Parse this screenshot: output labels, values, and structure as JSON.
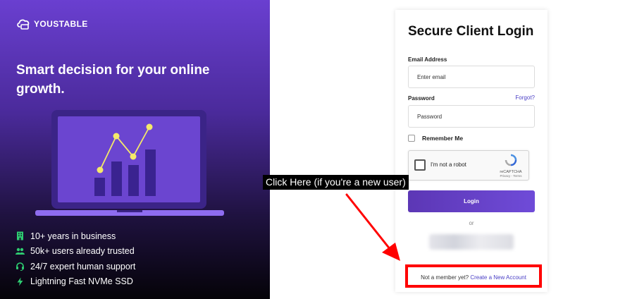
{
  "brand": {
    "name": "YOUSTABLE"
  },
  "promo": {
    "headline": "Smart decision for your online growth.",
    "features": [
      {
        "icon": "building-icon",
        "text": "10+ years in business"
      },
      {
        "icon": "users-icon",
        "text": "50k+ users already trusted"
      },
      {
        "icon": "headset-icon",
        "text": "24/7 expert human support"
      },
      {
        "icon": "lightning-icon",
        "text": "Lightning Fast NVMe SSD"
      }
    ]
  },
  "login": {
    "title": "Secure Client Login",
    "email_label": "Email Address",
    "email_placeholder": "Enter email",
    "password_label": "Password",
    "forgot_label": "Forgot?",
    "password_placeholder": "Password",
    "remember_label": "Remember Me",
    "recaptcha": {
      "text": "I'm not a robot",
      "brand": "reCAPTCHA",
      "links": "Privacy - Terms"
    },
    "login_button": "Login",
    "or_text": "or",
    "signup_prompt": "Not a member yet?",
    "signup_link": "Create a New Account"
  },
  "annotation": {
    "callout": "Click Here (if you're a new user)"
  },
  "colors": {
    "accent": "#6a3fd0",
    "link": "#4a3fc5",
    "highlight": "#ff0000",
    "feature_icon": "#2ecc71"
  }
}
